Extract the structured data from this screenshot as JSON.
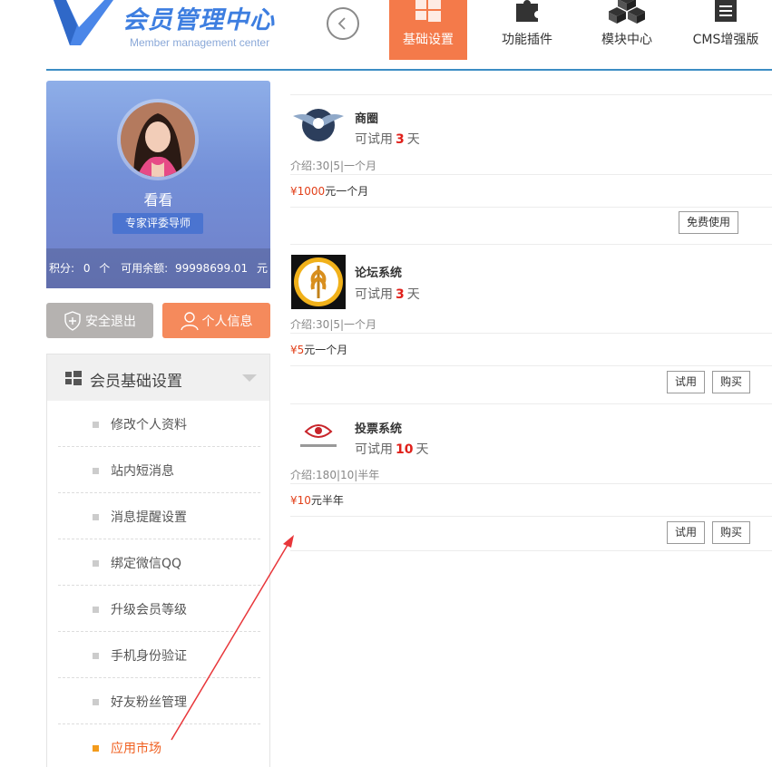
{
  "brand": {
    "title": "会员管理中心",
    "subtitle": "Member management center",
    "accent": "#3d7ee0"
  },
  "nav": {
    "back_icon": "circle-chevron-left-icon",
    "tabs": [
      {
        "label": "基础设置",
        "icon": "windows-icon",
        "active": true
      },
      {
        "label": "功能插件",
        "icon": "puzzle-icon",
        "active": false
      },
      {
        "label": "模块中心",
        "icon": "cubes-icon",
        "active": false
      },
      {
        "label": "CMS增强版",
        "icon": "document-icon",
        "active": false
      }
    ],
    "active_color": "#f47a4a"
  },
  "profile": {
    "username": "看看",
    "role": "专家评委导师",
    "stats": {
      "points_label": "积分:",
      "points_value": "0",
      "points_unit": "个",
      "balance_label": "可用余额:",
      "balance_value": "99998699.01",
      "balance_unit": "元"
    }
  },
  "actions": {
    "logout": "安全退出",
    "profile": "个人信息"
  },
  "menu": {
    "title": "会员基础设置",
    "items": [
      {
        "label": "修改个人资料",
        "active": false
      },
      {
        "label": "站内短消息",
        "active": false
      },
      {
        "label": "消息提醒设置",
        "active": false
      },
      {
        "label": "绑定微信QQ",
        "active": false
      },
      {
        "label": "升级会员等级",
        "active": false
      },
      {
        "label": "手机身份验证",
        "active": false
      },
      {
        "label": "好友粉丝管理",
        "active": false
      },
      {
        "label": "应用市场",
        "active": true
      }
    ]
  },
  "apps": [
    {
      "name": "商圈",
      "trial_prefix": "可试用",
      "trial_days": "3",
      "trial_suffix": "天",
      "intro": "介绍:30|5|一个月",
      "price_currency": "¥1000",
      "price_text": "元一个月",
      "buttons": [
        "免费使用"
      ]
    },
    {
      "name": "论坛系统",
      "trial_prefix": "可试用",
      "trial_days": "3",
      "trial_suffix": "天",
      "intro": "介绍:30|5|一个月",
      "price_currency": "¥5",
      "price_text": "元一个月",
      "buttons": [
        "试用",
        "购买"
      ]
    },
    {
      "name": "投票系统",
      "trial_prefix": "可试用",
      "trial_days": "10",
      "trial_suffix": "天",
      "intro": "介绍:180|10|半年",
      "price_currency": "¥10",
      "price_text": "元半年",
      "buttons": [
        "试用",
        "购买"
      ]
    }
  ]
}
